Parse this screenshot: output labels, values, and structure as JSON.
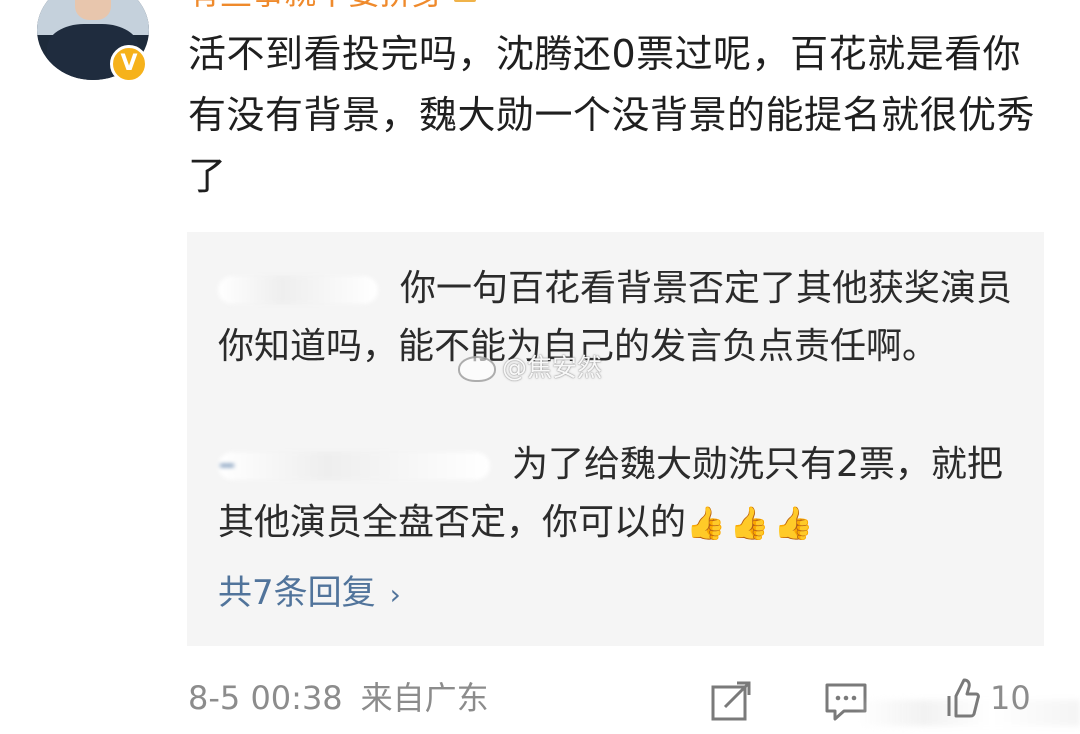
{
  "comment": {
    "username": "有些事就不要拼身",
    "text": "活不到看投完吗，沈腾还0票过呢，百花就是看你有没有背景，魏大勋一个没背景的能提名就很优秀了",
    "verified_badge": "V"
  },
  "replies": {
    "items": [
      {
        "text": "你一句百花看背景否定了其他获奖演员你知道吗，能不能为自己的发言负点责任啊。"
      },
      {
        "text": "为了给魏大勋洗只有2票，就把其他演员全盘否定，你可以的",
        "emoji": "👍👍👍"
      }
    ],
    "more_label": "共7条回复",
    "more_chevron": "›"
  },
  "watermark": {
    "text": "@焦安然"
  },
  "footer": {
    "time": "8-5 00:38",
    "location": "来自广东",
    "like_count": "10"
  },
  "icons": {
    "share": "share-icon",
    "comment": "comment-icon",
    "like": "like-icon"
  },
  "colors": {
    "username": "#ef8a2c",
    "link": "#51749b",
    "meta": "#8c8c8c",
    "reply_bg": "#f5f5f5",
    "verified": "#f6b21b"
  }
}
